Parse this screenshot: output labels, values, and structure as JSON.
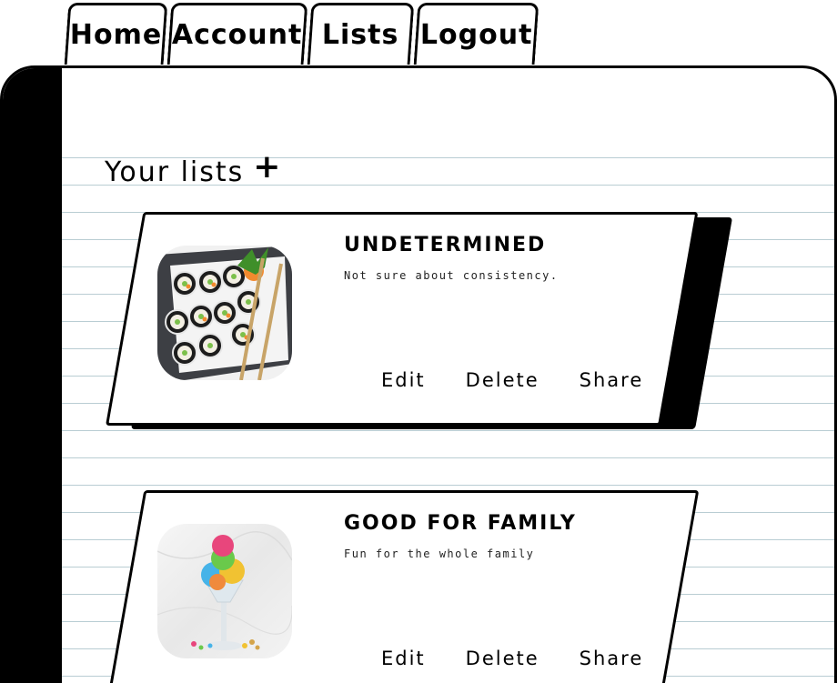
{
  "tabs": [
    {
      "label": "Home"
    },
    {
      "label": "Account"
    },
    {
      "label": "Lists"
    },
    {
      "label": "Logout"
    }
  ],
  "heading": {
    "text": "Your lists",
    "add_icon": "plus-icon"
  },
  "lists": [
    {
      "title": "UNDETERMINED",
      "description": "Not sure about consistency.",
      "image": "sushi-rolls-image",
      "actions": {
        "edit": "Edit",
        "delete": "Delete",
        "share": "Share"
      }
    },
    {
      "title": "GOOD FOR FAMILY",
      "description": "Fun for the whole family",
      "image": "ice-cream-sundae-image",
      "actions": {
        "edit": "Edit",
        "delete": "Delete",
        "share": "Share"
      }
    }
  ],
  "colors": {
    "ink": "#000000",
    "paper": "#ffffff",
    "rule_line": "#b9cdd3"
  }
}
